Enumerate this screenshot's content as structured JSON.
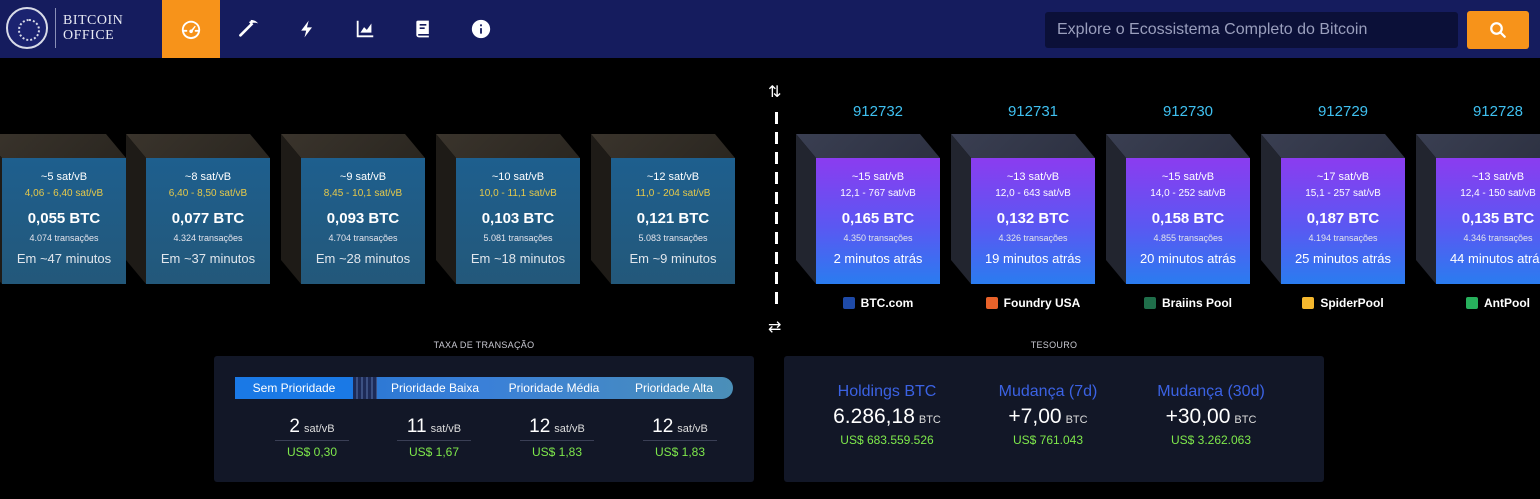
{
  "header": {
    "logo_text_1": "BITCOIN",
    "logo_text_2": "OFFICE",
    "nav": [
      {
        "icon": "dashboard-icon",
        "active": true
      },
      {
        "icon": "pickaxe-icon",
        "active": false
      },
      {
        "icon": "lightning-icon",
        "active": false
      },
      {
        "icon": "chart-icon",
        "active": false
      },
      {
        "icon": "book-icon",
        "active": false
      },
      {
        "icon": "info-icon",
        "active": false
      }
    ],
    "search_placeholder": "Explore o Ecossistema Completo do Bitcoin",
    "search_icon": "search-icon"
  },
  "pending_blocks": [
    {
      "fee": "~5 sat/vB",
      "range": "4,06 - 6,40 sat/vB",
      "btc": "0,055 BTC",
      "tx": "4.074 transações",
      "time": "Em ~47 minutos"
    },
    {
      "fee": "~8 sat/vB",
      "range": "6,40 - 8,50 sat/vB",
      "btc": "0,077 BTC",
      "tx": "4.324 transações",
      "time": "Em ~37 minutos"
    },
    {
      "fee": "~9 sat/vB",
      "range": "8,45 - 10,1 sat/vB",
      "btc": "0,093 BTC",
      "tx": "4.704 transações",
      "time": "Em ~28 minutos"
    },
    {
      "fee": "~10 sat/vB",
      "range": "10,0 - 11,1 sat/vB",
      "btc": "0,103 BTC",
      "tx": "5.081 transações",
      "time": "Em ~18 minutos"
    },
    {
      "fee": "~12 sat/vB",
      "range": "11,0 - 204 sat/vB",
      "btc": "0,121 BTC",
      "tx": "5.083 transações",
      "time": "Em ~9 minutos"
    }
  ],
  "mined_blocks": [
    {
      "height": "912732",
      "fee": "~15 sat/vB",
      "range": "12,1 - 767 sat/vB",
      "btc": "0,165 BTC",
      "tx": "4.350 transações",
      "time": "2 minutos atrás",
      "pool": "BTC.com",
      "pool_color": "#1e4aa8"
    },
    {
      "height": "912731",
      "fee": "~13 sat/vB",
      "range": "12,0 - 643 sat/vB",
      "btc": "0,132 BTC",
      "tx": "4.326 transações",
      "time": "19 minutos atrás",
      "pool": "Foundry USA",
      "pool_color": "#e8622a"
    },
    {
      "height": "912730",
      "fee": "~15 sat/vB",
      "range": "14,0 - 252 sat/vB",
      "btc": "0,158 BTC",
      "tx": "4.855 transações",
      "time": "20 minutos atrás",
      "pool": "Braiins Pool",
      "pool_color": "#1f6e4a"
    },
    {
      "height": "912729",
      "fee": "~17 sat/vB",
      "range": "15,1 - 257 sat/vB",
      "btc": "0,187 BTC",
      "tx": "4.194 transações",
      "time": "25 minutos atrás",
      "pool": "SpiderPool",
      "pool_color": "#f5b82e"
    },
    {
      "height": "912728",
      "fee": "~13 sat/vB",
      "range": "12,4 - 150 sat/vB",
      "btc": "0,135 BTC",
      "tx": "4.346 transações",
      "time": "44 minutos atrás",
      "pool": "AntPool",
      "pool_color": "#27b05c"
    }
  ],
  "fees": {
    "title": "TAXA DE TRANSAÇÃO",
    "priorities": [
      "Sem Prioridade",
      "Prioridade Baixa",
      "Prioridade Média",
      "Prioridade Alta"
    ],
    "values": [
      {
        "val": "2",
        "unit": "sat/vB",
        "usd": "US$ 0,30"
      },
      {
        "val": "11",
        "unit": "sat/vB",
        "usd": "US$ 1,67"
      },
      {
        "val": "12",
        "unit": "sat/vB",
        "usd": "US$ 1,83"
      },
      {
        "val": "12",
        "unit": "sat/vB",
        "usd": "US$ 1,83"
      }
    ]
  },
  "treasury": {
    "title": "TESOURO",
    "items": [
      {
        "label": "Holdings BTC",
        "val": "6.286,18",
        "unit": "BTC",
        "usd": "US$ 683.559.526"
      },
      {
        "label": "Mudança (7d)",
        "val": "+7,00",
        "unit": "BTC",
        "usd": "US$ 761.043"
      },
      {
        "label": "Mudança (30d)",
        "val": "+30,00",
        "unit": "BTC",
        "usd": "US$ 3.262.063"
      }
    ]
  },
  "colors": {
    "accent": "#f7931a",
    "header_bg": "#151c5e",
    "height_text": "#3fc0f0",
    "usd_green": "#7ee84b",
    "treasury_label": "#3b62e3"
  }
}
